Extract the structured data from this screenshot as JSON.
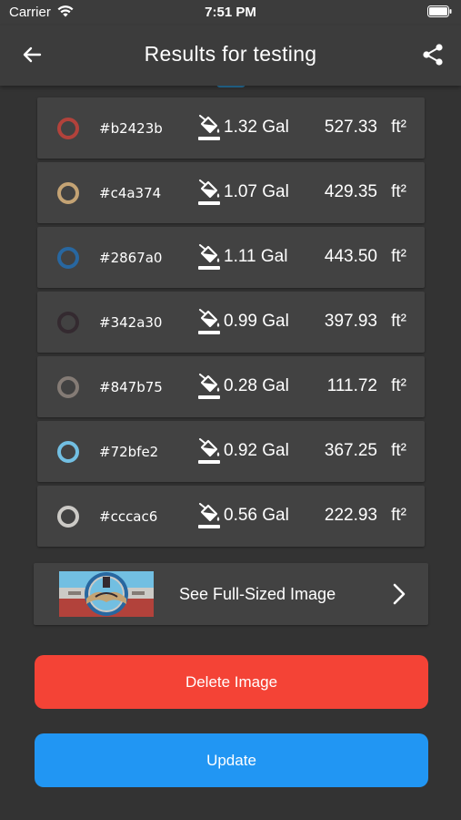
{
  "status_bar": {
    "carrier": "Carrier",
    "time": "7:51 PM",
    "icons": [
      "wifi-icon",
      "battery-icon"
    ]
  },
  "app_bar": {
    "title": "Results for testing",
    "back_icon": "back-arrow-icon",
    "share_icon": "share-icon"
  },
  "colors": [
    {
      "hex": "#b2423b",
      "gallons": "1.32 Gal",
      "area": "527.33",
      "unit": "ft²",
      "swatch": "#b2423b"
    },
    {
      "hex": "#c4a374",
      "gallons": "1.07 Gal",
      "area": "429.35",
      "unit": "ft²",
      "swatch": "#c4a374"
    },
    {
      "hex": "#2867a0",
      "gallons": "1.11 Gal",
      "area": "443.50",
      "unit": "ft²",
      "swatch": "#2867a0"
    },
    {
      "hex": "#342a30",
      "gallons": "0.99 Gal",
      "area": "397.93",
      "unit": "ft²",
      "swatch": "#342a30"
    },
    {
      "hex": "#847b75",
      "gallons": "0.28 Gal",
      "area": "111.72",
      "unit": "ft²",
      "swatch": "#847b75"
    },
    {
      "hex": "#72bfe2",
      "gallons": "0.92 Gal",
      "area": "367.25",
      "unit": "ft²",
      "swatch": "#72bfe2"
    },
    {
      "hex": "#cccac6",
      "gallons": "0.56 Gal",
      "area": "222.93",
      "unit": "ft²",
      "swatch": "#cccac6"
    }
  ],
  "image_card": {
    "label": "See Full-Sized Image",
    "icon": "chevron-right-icon"
  },
  "buttons": {
    "delete_label": "Delete Image",
    "update_label": "Update"
  },
  "theme": {
    "background": "#333333",
    "card": "#424242",
    "delete_color": "#f44336",
    "update_color": "#2196f3"
  }
}
